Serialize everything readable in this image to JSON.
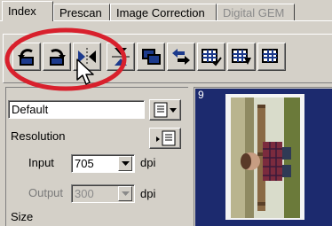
{
  "tabs": [
    {
      "label": "Index",
      "active": true,
      "enabled": true
    },
    {
      "label": "Prescan",
      "active": false,
      "enabled": true
    },
    {
      "label": "Image Correction",
      "active": false,
      "enabled": true
    },
    {
      "label": "Digital GEM",
      "active": false,
      "enabled": false
    }
  ],
  "toolbar": {
    "buttons": [
      {
        "icon": "rotate-left-icon"
      },
      {
        "icon": "rotate-right-icon"
      },
      {
        "icon": "flip-horizontal-icon"
      },
      {
        "icon": "flip-vertical-icon"
      },
      {
        "icon": "select-frames-icon"
      },
      {
        "icon": "swap-icon"
      },
      {
        "icon": "grid-check-icon"
      },
      {
        "icon": "grid-check-2-icon"
      },
      {
        "icon": "grid-icon"
      }
    ],
    "highlight_color": "#d8202c"
  },
  "settings": {
    "preset_value": "Default",
    "resolution_label": "Resolution",
    "input_label": "Input",
    "input_value": "705",
    "input_unit": "dpi",
    "output_label": "Output",
    "output_value": "300",
    "output_unit": "dpi",
    "size_label": "Size"
  },
  "thumbnail": {
    "frame_number": "9",
    "background": "#1c2a6e"
  }
}
